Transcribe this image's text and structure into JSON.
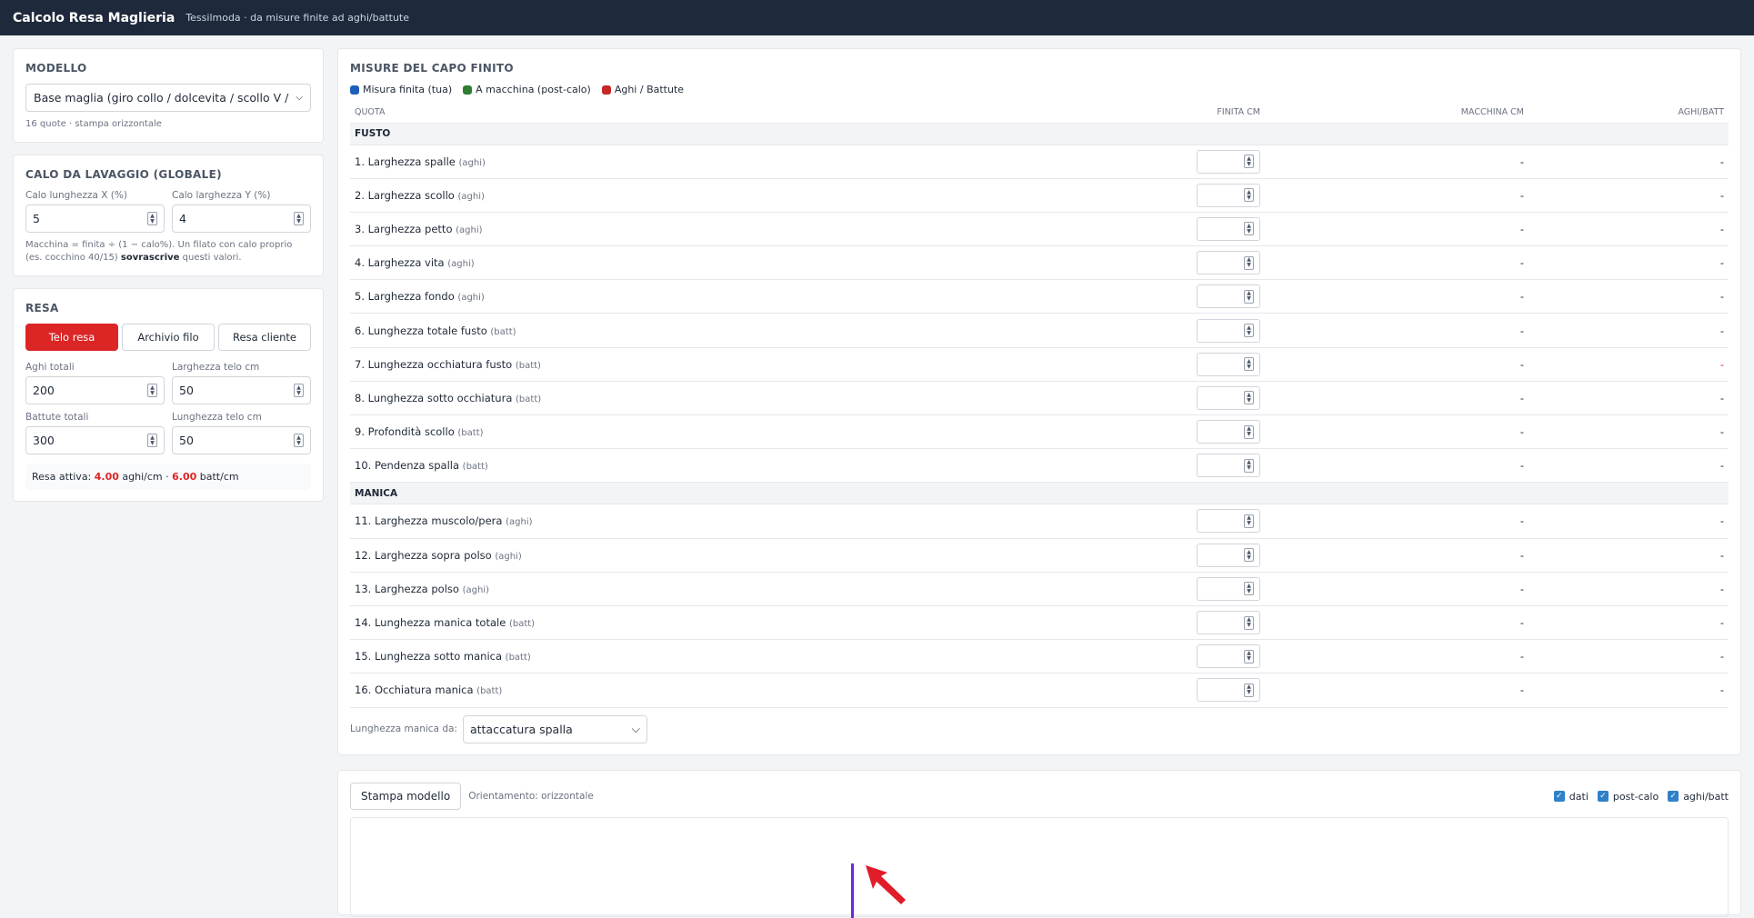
{
  "header": {
    "title": "Calcolo Resa Maglieria",
    "subtitle": "Tessilmoda · da misure finite ad aghi/battute"
  },
  "modello": {
    "title": "MODELLO",
    "selected": "Base maglia (giro collo / dolcevita / scollo V / giacca)",
    "info": "16 quote · stampa orizzontale"
  },
  "calo": {
    "title": "CALO DA LAVAGGIO (GLOBALE)",
    "x_label": "Calo lunghezza X (%)",
    "x_value": "5",
    "y_label": "Calo larghezza Y (%)",
    "y_value": "4",
    "note_pre": "Macchina = finita ÷ (1 − calo%). Un filato con calo proprio (es. cocchino 40/15)",
    "note_bold": "sovrascrive",
    "note_post": "questi valori."
  },
  "resa": {
    "title": "RESA",
    "tabs": [
      "Telo resa",
      "Archivio filo",
      "Resa cliente"
    ],
    "active_tab": "Telo resa",
    "aghi_label": "Aghi totali",
    "aghi_value": "200",
    "larghezza_label": "Larghezza telo cm",
    "larghezza_value": "50",
    "battute_label": "Battute totali",
    "battute_value": "300",
    "lunghezza_label": "Lunghezza telo cm",
    "lunghezza_value": "50",
    "attiva_label": "Resa attiva:",
    "aghi_cm": "4.00",
    "aghi_cm_unit": "aghi/cm ·",
    "batt_cm": "6.00",
    "batt_cm_unit": "batt/cm"
  },
  "misure": {
    "title": "MISURE DEL CAPO FINITO",
    "legend": [
      {
        "label": "Misura finita (tua)",
        "color": "#1d5fb8"
      },
      {
        "label": "A macchina (post-calo)",
        "color": "#2e7d32"
      },
      {
        "label": "Aghi / Battute",
        "color": "#c62828"
      }
    ],
    "columns": {
      "quota": "QUOTA",
      "finita": "FINITA CM",
      "macchina": "MACCHINA CM",
      "aghi": "AGHI/BATT"
    },
    "sections": [
      {
        "name": "FUSTO",
        "rows": [
          {
            "label": "1. Larghezza spalle",
            "unit": "(aghi)",
            "macchina": "-",
            "aghi": "-"
          },
          {
            "label": "2. Larghezza scollo",
            "unit": "(aghi)",
            "macchina": "-",
            "aghi": "-"
          },
          {
            "label": "3. Larghezza petto",
            "unit": "(aghi)",
            "macchina": "-",
            "aghi": "-"
          },
          {
            "label": "4. Larghezza vita",
            "unit": "(aghi)",
            "macchina": "-",
            "aghi": "-"
          },
          {
            "label": "5. Larghezza fondo",
            "unit": "(aghi)",
            "macchina": "-",
            "aghi": "-"
          },
          {
            "label": "6. Lunghezza totale fusto",
            "unit": "(batt)",
            "macchina": "-",
            "aghi": "-"
          },
          {
            "label": "7. Lunghezza occhiatura fusto",
            "unit": "(batt)",
            "macchina": "-",
            "aghi": "-"
          },
          {
            "label": "8. Lunghezza sotto occhiatura",
            "unit": "(batt)",
            "macchina": "-",
            "aghi": "-"
          },
          {
            "label": "9. Profondità scollo",
            "unit": "(batt)",
            "macchina": "-",
            "aghi": "-"
          },
          {
            "label": "10. Pendenza spalla",
            "unit": "(batt)",
            "macchina": "-",
            "aghi": "-"
          }
        ]
      },
      {
        "name": "MANICA",
        "rows": [
          {
            "label": "11. Larghezza muscolo/pera",
            "unit": "(aghi)",
            "macchina": "-",
            "aghi": "-"
          },
          {
            "label": "12. Larghezza sopra polso",
            "unit": "(aghi)",
            "macchina": "-",
            "aghi": "-"
          },
          {
            "label": "13. Larghezza polso",
            "unit": "(aghi)",
            "macchina": "-",
            "aghi": "-"
          },
          {
            "label": "14. Lunghezza manica totale",
            "unit": "(batt)",
            "macchina": "-",
            "aghi": "-"
          },
          {
            "label": "15. Lunghezza sotto manica",
            "unit": "(batt)",
            "macchina": "-",
            "aghi": "-"
          },
          {
            "label": "16. Occhiatura manica",
            "unit": "(batt)",
            "macchina": "-",
            "aghi": "-"
          }
        ]
      }
    ],
    "manica_label": "Lunghezza manica da:",
    "manica_value": "attaccatura spalla"
  },
  "stampa": {
    "button": "Stampa modello",
    "orientamento": "Orientamento: orizzontale",
    "checks": [
      "dati",
      "post-calo",
      "aghi/batt"
    ]
  }
}
